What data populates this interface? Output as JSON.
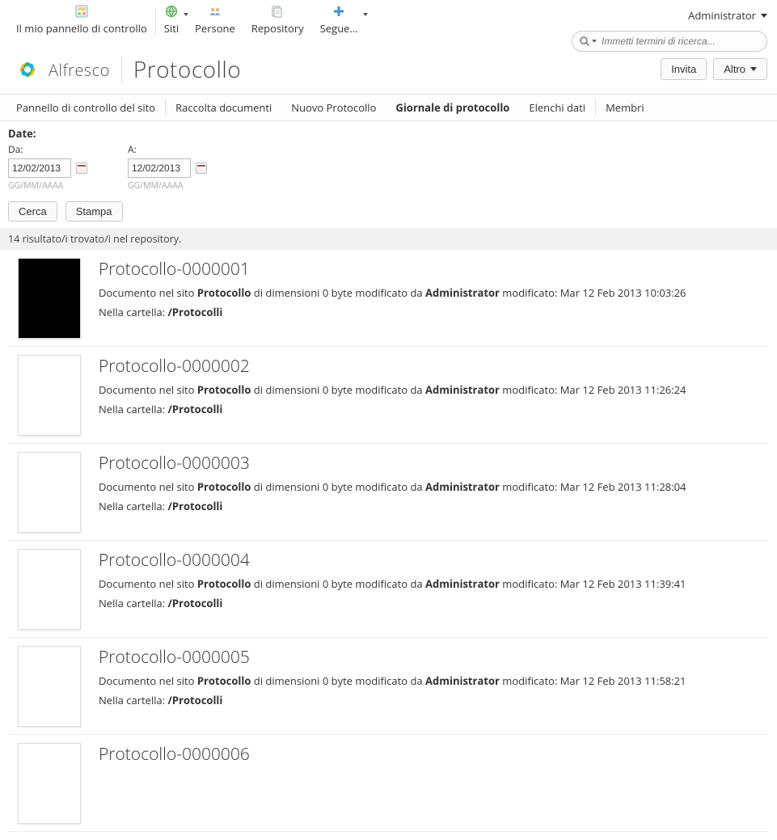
{
  "toolbar": {
    "dashboard": "Il mio pannello di controllo",
    "sites": "Siti",
    "people": "Persone",
    "repository": "Repository",
    "more": "Segue…"
  },
  "user": {
    "name": "Administrator"
  },
  "search": {
    "placeholder": "Immetti termini di ricerca..."
  },
  "brand": {
    "name": "Alfresco"
  },
  "site": {
    "title": "Protocollo",
    "invite": "Invita",
    "more": "Altro"
  },
  "nav": {
    "dashboard": "Pannello di controllo del sito",
    "doclib": "Raccolta documenti",
    "nuovo": "Nuovo Protocollo",
    "giornale": "Giornale di protocollo",
    "elenchi": "Elenchi dati",
    "membri": "Membri"
  },
  "filters": {
    "date_label": "Date:",
    "from_label": "Da:",
    "to_label": "A:",
    "from_value": "12/02/2013",
    "to_value": "12/02/2013",
    "hint": "GG/MM/AAAA",
    "search": "Cerca",
    "print": "Stampa"
  },
  "results_summary": "14 risultato/i trovato/i nel repository.",
  "item_strings": {
    "doc_in_site_prefix": "Documento nel sito ",
    "site_name": "Protocollo",
    "size_and_modby": " di dimensioni 0 byte modificato da ",
    "modifier": "Administrator",
    "folder_prefix": "Nella cartella: ",
    "folder_path": "/Protocolli"
  },
  "items": [
    {
      "title": "Protocollo-0000001",
      "modified": " modificato: Mar 12 Feb 2013 10:03:26",
      "thumb": "black"
    },
    {
      "title": "Protocollo-0000002",
      "modified": " modificato: Mar 12 Feb 2013 11:26:24",
      "thumb": "white"
    },
    {
      "title": "Protocollo-0000003",
      "modified": " modificato: Mar 12 Feb 2013 11:28:04",
      "thumb": "white"
    },
    {
      "title": "Protocollo-0000004",
      "modified": " modificato: Mar 12 Feb 2013 11:39:41",
      "thumb": "white"
    },
    {
      "title": "Protocollo-0000005",
      "modified": " modificato: Mar 12 Feb 2013 11:58:21",
      "thumb": "white"
    },
    {
      "title": "Protocollo-0000006",
      "modified": "",
      "thumb": "white"
    }
  ]
}
